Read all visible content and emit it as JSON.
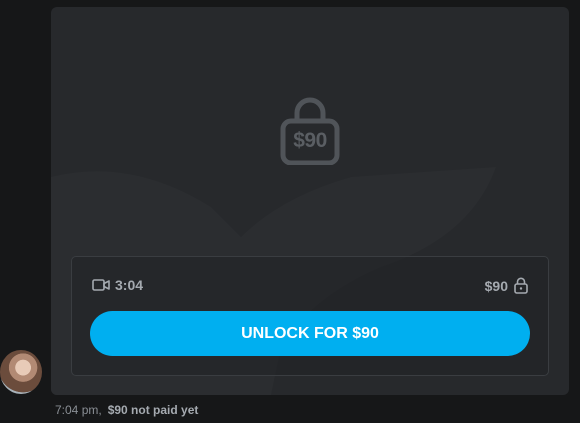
{
  "message": {
    "locked_price_badge": "$90",
    "duration": "3:04",
    "price": "$90",
    "unlock_button_label": "UNLOCK FOR $90",
    "time": "7:04 pm,",
    "payment_status": "$90 not paid yet"
  },
  "colors": {
    "accent": "#00aff0",
    "bubble_bg": "#27292c",
    "page_bg": "#161718",
    "muted_text": "#a5aab0"
  },
  "icons": {
    "lock_large": "lock-icon",
    "video": "video-camera-icon",
    "lock_small": "lock-icon"
  }
}
